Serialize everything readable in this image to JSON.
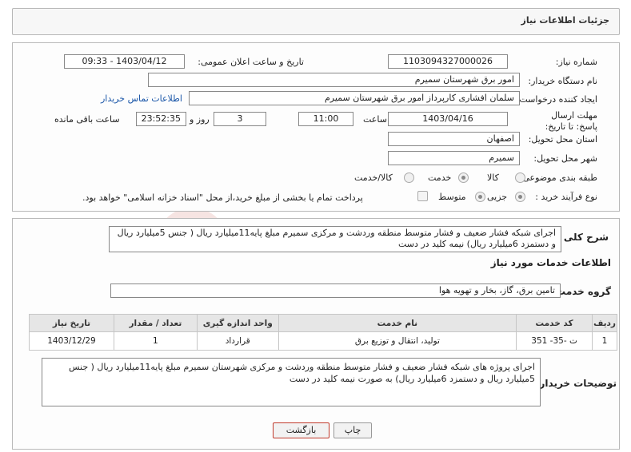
{
  "header": {
    "title": "جزئیات اطلاعات نیاز"
  },
  "form": {
    "need_number_label": "شماره نیاز:",
    "need_number": "1103094327000026",
    "announce_label": "تاریخ و ساعت اعلان عمومی:",
    "announce_value": "1403/04/12 - 09:33",
    "buyer_org_label": "نام دستگاه خریدار:",
    "buyer_org": "امور برق شهرستان سمیرم",
    "creator_label": "ایجاد کننده درخواست:",
    "creator": "سلمان  افشاری کارپرداز امور برق شهرستان سمیرم",
    "contact_link": "اطلاعات تماس خریدار",
    "deadline_label": "مهلت ارسال پاسخ: تا تاریخ:",
    "deadline_date": "1403/04/16",
    "time_label": "ساعت",
    "deadline_time": "11:00",
    "days_value": "3",
    "days_label": "روز و",
    "remaining_time": "23:52:35",
    "remaining_label": "ساعت باقی مانده",
    "province_label": "استان محل تحویل:",
    "province": "اصفهان",
    "city_label": "شهر محل تحویل:",
    "city": "سمیرم",
    "category_label": "طبقه بندی موضوعی:",
    "category_options": [
      "کالا",
      "خدمت",
      "کالا/خدمت"
    ],
    "category_selected": "خدمت",
    "process_label": "نوع فرآیند خرید :",
    "process_options": [
      "جزیی",
      "متوسط"
    ],
    "process_selected": "جزیی",
    "payment_note": "پرداخت تمام یا بخشی از مبلغ خرید،از محل \"اسناد خزانه اسلامی\" خواهد بود."
  },
  "summary": {
    "label": "شرح کلی نیاز:",
    "text": "اجرای شبکه فشار ضعیف و فشار متوسط  منطقه وردشت و مرکزی  سمیرم  مبلغ پایه11میلیارد ریال ( جنس 5میلیارد ریال و دستمزد 6میلیارد ریال) نیمه کلید در دست"
  },
  "services": {
    "section_title": "اطلاعات خدمات مورد نیاز",
    "group_label": "گروه خدمت:",
    "group_value": "تامین برق، گاز، بخار و تهویه هوا",
    "columns": [
      "ردیف",
      "کد خدمت",
      "نام خدمت",
      "واحد اندازه گیری",
      "تعداد / مقدار",
      "تاریخ نیاز"
    ],
    "rows": [
      [
        "1",
        "ت -35- 351",
        "تولید، انتقال و توزیع برق",
        "قرارداد",
        "1",
        "1403/12/29"
      ]
    ]
  },
  "buyer_notes": {
    "label": "توضیحات خریدار:",
    "text": "اجرای پروژه های شبکه فشار ضعیف و فشار متوسط  منطقه وردشت و مرکزی شهرستان سمیرم  مبلغ پایه11میلیارد ریال ( جنس 5میلیارد ریال و دستمزد 6میلیارد ریال) به صورت نیمه کلید در دست"
  },
  "buttons": {
    "print": "چاپ",
    "back": "بازگشت"
  },
  "watermark_text": "AriaTender.neT",
  "colors": {
    "link": "#1a56a8",
    "back_button_border": "#c0392b",
    "watermark": "#c0392b"
  }
}
